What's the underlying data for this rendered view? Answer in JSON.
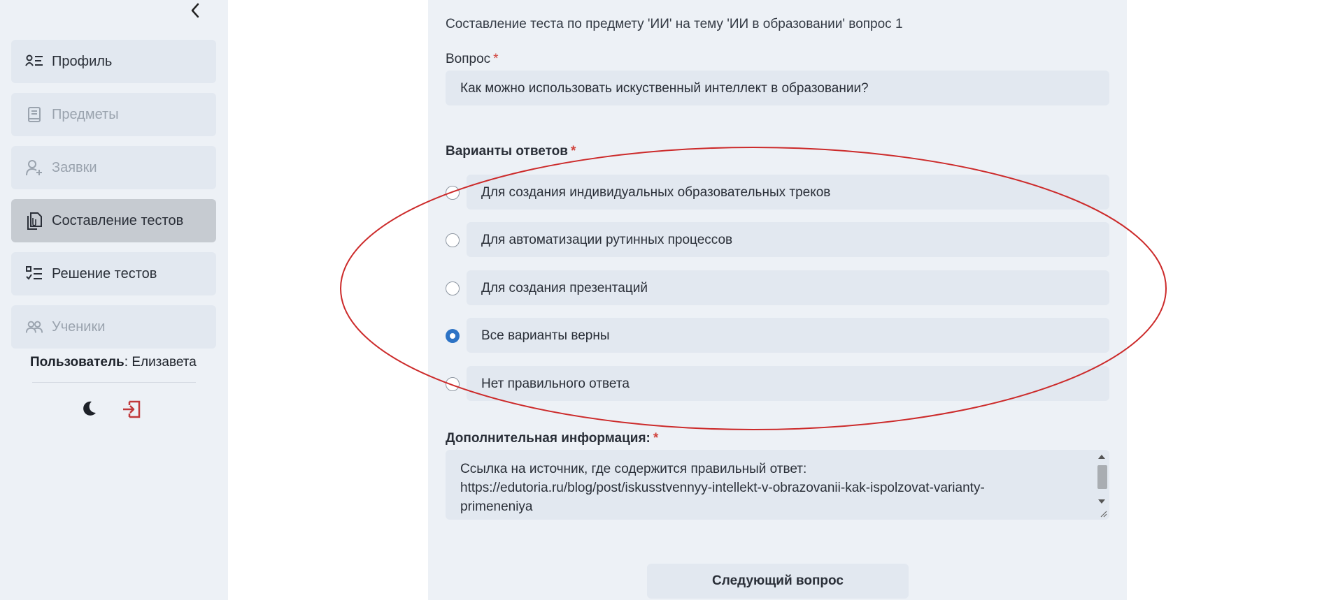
{
  "sidebar": {
    "items": [
      {
        "label": "Профиль",
        "icon": "profile-list-icon",
        "state": "normal"
      },
      {
        "label": "Предметы",
        "icon": "book-icon",
        "state": "disabled"
      },
      {
        "label": "Заявки",
        "icon": "user-add-icon",
        "state": "disabled"
      },
      {
        "label": "Составление тестов",
        "icon": "documents-icon",
        "state": "active"
      },
      {
        "label": "Решение тестов",
        "icon": "checklist-icon",
        "state": "normal"
      },
      {
        "label": "Ученики",
        "icon": "users-icon",
        "state": "disabled"
      }
    ],
    "user_label": "Пользователь",
    "user_name": "Елизавета"
  },
  "main": {
    "header": "Составление теста по предмету 'ИИ' на тему 'ИИ в образовании' вопрос 1",
    "question_label": "Вопрос",
    "question_value": "Как можно использовать искуственный интеллект в образовании?",
    "answers_label": "Варианты ответов",
    "answers": [
      {
        "text": "Для создания индивидуальных образовательных треков",
        "checked": false
      },
      {
        "text": "Для автоматизации рутинных процессов",
        "checked": false
      },
      {
        "text": "Для создания презентаций",
        "checked": false
      },
      {
        "text": "Все варианты верны",
        "checked": true
      },
      {
        "text": "Нет правильного ответа",
        "checked": false
      }
    ],
    "extra_label": "Дополнительная информация:",
    "extra_lines": [
      "Ссылка на источник, где содержится правильный ответ:",
      "https://edutoria.ru/blog/post/iskusstvennyy-intellekt-v-obrazovanii-kak-ispolzovat-varianty-",
      "primeneniya"
    ],
    "required_mark": "*",
    "next_button": "Следующий вопрос"
  },
  "colors": {
    "accent": "#2d73c5",
    "required": "#d0433c",
    "annotation": "#cc2a2a",
    "logout": "#c0383a"
  }
}
